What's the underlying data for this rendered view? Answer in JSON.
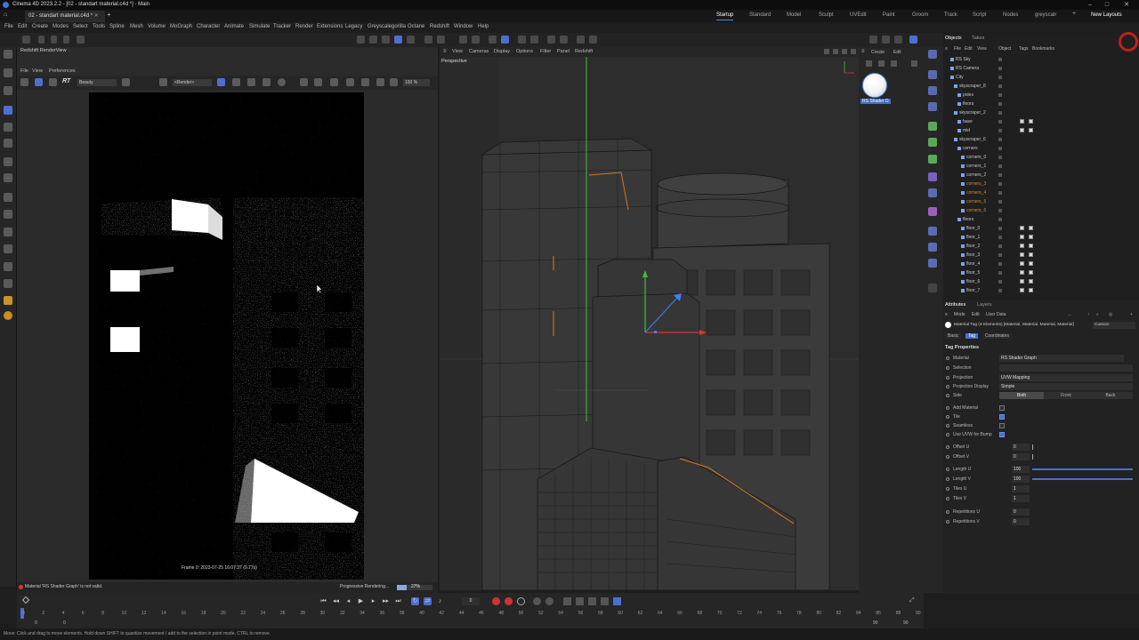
{
  "window": {
    "title": "Cinema 4D 2023.2.2 - [02 - standart material.c4d *] - Main"
  },
  "tabs": {
    "doc": "02 - standart material.c4d *",
    "layouts": [
      "Startup",
      "Standard",
      "Model",
      "Sculpt",
      "UVEdit",
      "Paint",
      "Groom",
      "Track",
      "Script",
      "Nodes",
      "greyscalr"
    ],
    "new_layouts": "New Layouts"
  },
  "menu": [
    "File",
    "Edit",
    "Create",
    "Modes",
    "Select",
    "Tools",
    "Spline",
    "Mesh",
    "Volume",
    "MoGraph",
    "Character",
    "Animate",
    "Simulate",
    "Tracker",
    "Render",
    "Extensions",
    "Legacy",
    "Greyscalegorilla",
    "Octane",
    "Redshift",
    "Window",
    "Help"
  ],
  "renderview": {
    "title": "Redshift RenderView",
    "menu": [
      "File",
      "View",
      "Preferences"
    ],
    "rt": "RT",
    "beauty": "Beauty",
    "render_dd": "<Render>",
    "zoom": "100 %",
    "frame_info": "Frame 0: 2023-07-25 16:07:37 (0.77s)",
    "status_error": "Material 'RS Shader Graph' is not valid.",
    "progress_label": "Progressive Rendering...",
    "progress_pct": "27%"
  },
  "viewport": {
    "menu": [
      "View",
      "Cameras",
      "Display",
      "Options",
      "Filter",
      "Panel",
      "Redshift"
    ],
    "label": "Perspective"
  },
  "material_manager": {
    "menu": [
      "Create",
      "Edit"
    ],
    "material_name": "RS Shader G"
  },
  "objects": {
    "tabs": [
      "Objects",
      "Takes"
    ],
    "menu": [
      "File",
      "Edit",
      "View",
      "Object",
      "Tags",
      "Bookmarks"
    ],
    "rows": [
      {
        "name": "RS Sky",
        "indent": 0
      },
      {
        "name": "RS Camera",
        "indent": 0
      },
      {
        "name": "City",
        "indent": 0
      },
      {
        "name": "skyscraper_8",
        "indent": 1
      },
      {
        "name": "poles",
        "indent": 2
      },
      {
        "name": "floors",
        "indent": 2
      },
      {
        "name": "skyscraper_2",
        "indent": 1
      },
      {
        "name": "base",
        "indent": 2
      },
      {
        "name": "mid",
        "indent": 2
      },
      {
        "name": "skyscraper_6",
        "indent": 1
      },
      {
        "name": "corners",
        "indent": 2
      },
      {
        "name": "corners_0",
        "indent": 3
      },
      {
        "name": "corners_1",
        "indent": 3
      },
      {
        "name": "corners_2",
        "indent": 3
      },
      {
        "name": "corners_3",
        "indent": 3
      },
      {
        "name": "corners_4",
        "indent": 3
      },
      {
        "name": "corners_5",
        "indent": 3
      },
      {
        "name": "corners_6",
        "indent": 3
      },
      {
        "name": "floors",
        "indent": 2
      },
      {
        "name": "floor_0",
        "indent": 3
      },
      {
        "name": "floor_1",
        "indent": 3
      },
      {
        "name": "floor_2",
        "indent": 3
      },
      {
        "name": "floor_3",
        "indent": 3
      },
      {
        "name": "floor_4",
        "indent": 3
      },
      {
        "name": "floor_5",
        "indent": 3
      },
      {
        "name": "floor_6",
        "indent": 3
      },
      {
        "name": "floor_7",
        "indent": 3
      }
    ]
  },
  "attributes": {
    "tabs": [
      "Attributes",
      "Layers"
    ],
    "menu": [
      "Mode",
      "Edit",
      "User Data"
    ],
    "header": "Material Tag (4 Elements) [Material, Material, Material, Material]",
    "custom": "Custom",
    "subtabs": [
      "Basic",
      "Tag",
      "Coordinates"
    ],
    "section": "Tag Properties",
    "material_label": "Material",
    "material_value": "RS Shader Graph",
    "selection_label": "Selection",
    "projection_label": "Projection",
    "projection_value": "UVW Mapping",
    "projection_display_label": "Projection Display",
    "projection_display_value": "Simple",
    "side_label": "Side",
    "side_options": [
      "Both",
      "Front",
      "Back"
    ],
    "add_material": "Add Material",
    "tile": "Tile",
    "seamless": "Seamless",
    "use_uvw": "Use UVW for Bump",
    "offset_u": "Offset U",
    "offset_u_val": "0",
    "offset_v": "Offset V",
    "offset_v_val": "0",
    "length_u": "Length U",
    "length_u_val": "100",
    "length_v": "Length V",
    "length_v_val": "100",
    "tiles_u": "Tiles U",
    "tiles_u_val": "1",
    "tiles_v": "Tiles V",
    "tiles_v_val": "1",
    "rep_u": "Repetitions U",
    "rep_u_val": "0",
    "rep_v": "Repetitions V",
    "rep_v_val": "0"
  },
  "timeline": {
    "current_frame": "0",
    "ticks": [
      "0",
      "2",
      "4",
      "6",
      "8",
      "10",
      "12",
      "14",
      "16",
      "18",
      "20",
      "22",
      "24",
      "26",
      "28",
      "30",
      "32",
      "34",
      "36",
      "38",
      "40",
      "42",
      "44",
      "46",
      "48",
      "50",
      "52",
      "54",
      "56",
      "58",
      "60",
      "62",
      "64",
      "66",
      "68",
      "70",
      "72",
      "74",
      "76",
      "78",
      "80",
      "82",
      "84",
      "86",
      "88",
      "90"
    ],
    "start": "0",
    "start2": "0",
    "end": "90",
    "end2": "90"
  },
  "statusbar": "Move: Click and drag to move elements. Hold down SHIFT to quantize movement / add to the selection in point mode, CTRL to remove."
}
